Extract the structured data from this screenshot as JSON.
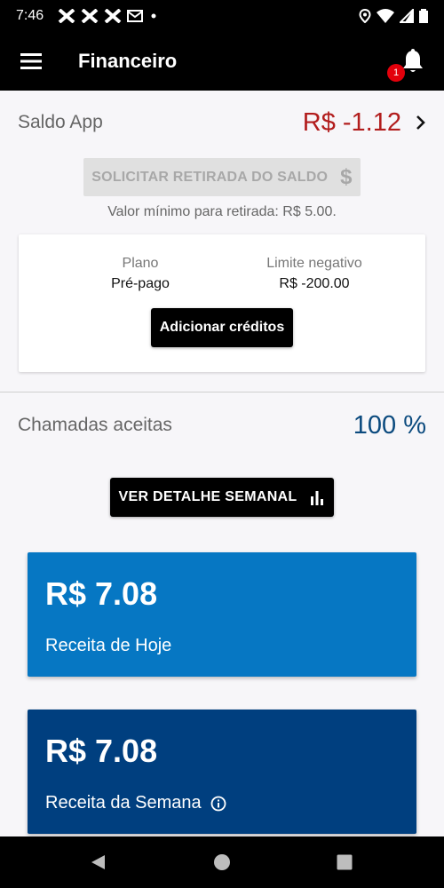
{
  "status_bar": {
    "time": "7:46",
    "notification_icons": [
      "app-x-icon",
      "app-x-icon",
      "app-x-icon",
      "gmail-icon",
      "dot-icon"
    ],
    "right_icons": [
      "location-icon",
      "wifi-icon",
      "signal-icon",
      "battery-icon"
    ]
  },
  "app_bar": {
    "title": "Financeiro",
    "notification_count": "1"
  },
  "saldo": {
    "label": "Saldo App",
    "value": "R$ -1.12"
  },
  "withdraw": {
    "button_label": "SOLICITAR RETIRADA DO SALDO",
    "icon": "$",
    "min_note": "Valor mínimo para retirada: R$ 5.00."
  },
  "plan": {
    "plan_label": "Plano",
    "plan_value": "Pré-pago",
    "limit_label": "Limite negativo",
    "limit_value": "R$ -200.00",
    "add_credits_label": "Adicionar créditos"
  },
  "calls": {
    "label": "Chamadas aceitas",
    "value": "100 %"
  },
  "weekly_button": {
    "label": "VER DETALHE SEMANAL"
  },
  "revenue": {
    "today": {
      "amount": "R$ 7.08",
      "label": "Receita de Hoje"
    },
    "week": {
      "amount": "R$ 7.08",
      "label": "Receita da Semana"
    }
  },
  "colors": {
    "negative_balance": "#b21d1d",
    "calls_value": "#0b4a7e",
    "today_card": "#0677c3",
    "week_card": "#003f7f",
    "badge": "#e3000b"
  }
}
